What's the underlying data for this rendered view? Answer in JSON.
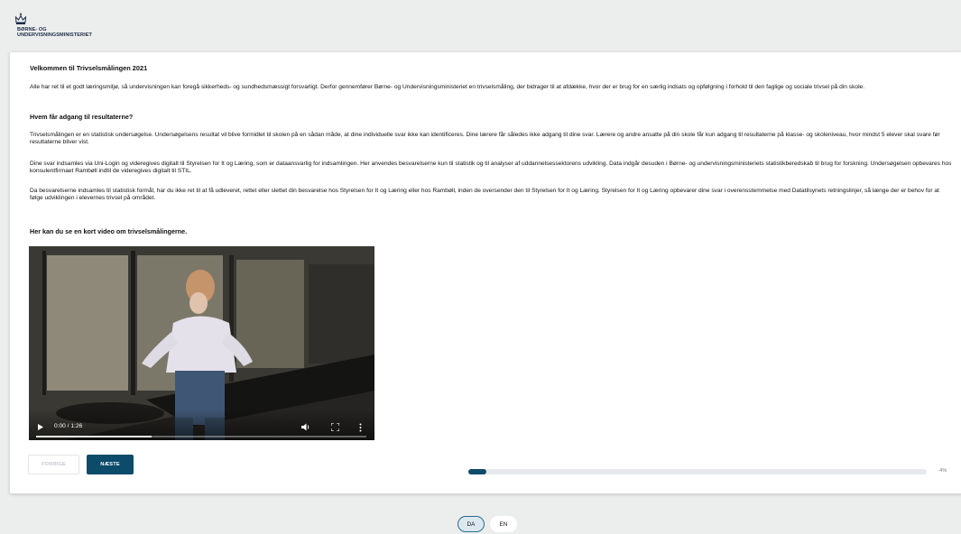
{
  "header": {
    "logo_line1": "BØRNE- OG",
    "logo_line2": "UNDERVISNINGSMINISTERIET"
  },
  "content": {
    "title": "Velkommen til Trivselsmålingen 2021",
    "intro": "Alle har ret til et godt læringsmiljø, så undervisningen kan foregå sikkerheds- og sundhedsmæssigt forsvarligt. Derfor gennemfører Børne- og Undervisningsministeriet en trivselsmåling, der bidrager til at afdække, hvor der er brug for en særlig indsats og opfølgning i forhold til den faglige og sociale trivsel på din skole.",
    "heading_access": "Hvem får adgang til resultaterne?",
    "paragraph_1": "Trivselsmålingen er en statistisk undersøgelse. Undersøgelsens resultat vil blive formidlet til skolen på en sådan måde, at dine individuelle svar ikke kan identificeres. Dine lærere får således ikke adgang til dine svar. Lærere og andre ansatte på din skole får kun adgang til resultaterne på klasse- og skoleniveau, hvor mindst 5 elever skal svare før resultaterne bliver vist.",
    "paragraph_2": "Dine svar indsamles via Uni-Login og videregives digitalt til Styrelsen for It og Læring, som er dataansvarlig for indsamlingen. Her anvendes besvarelserne kun til statistik og til analyser af uddannelsessektorens udvikling. Data indgår desuden i Børne- og undervisningsministeriets statistikberedskab til brug for forskning. Undersøgelsen opbevares hos konsulentfirmaet Rambøll indtil de videregives digitalt til STIL.",
    "paragraph_3": "Da besvarelserne indsamles til statistisk formål, har du ikke ret til at få udleveret, rettet eller slettet din besvarelse hos Styrelsen for It og Læring eller hos Rambøll, inden de oversender den til Styrelsen for It og Læring. Styrelsen for It og Læring opbevarer dine svar i overensstemmelse med Datatilsynets retningslinjer, så længe der er behov for at følge udviklingen i elevernes trivsel på området.",
    "video_heading": "Her kan du se en kort video om trivselsmålingerne."
  },
  "video": {
    "time": "0:00 / 1:26",
    "played_fraction": 0.35
  },
  "nav": {
    "prev_label": "FORRIGE",
    "next_label": "NÆSTE"
  },
  "progress": {
    "percent": 4,
    "label": "4%"
  },
  "languages": {
    "da": "DA",
    "en": "EN"
  },
  "colors": {
    "accent": "#0d4b6b",
    "background": "#eceded"
  }
}
